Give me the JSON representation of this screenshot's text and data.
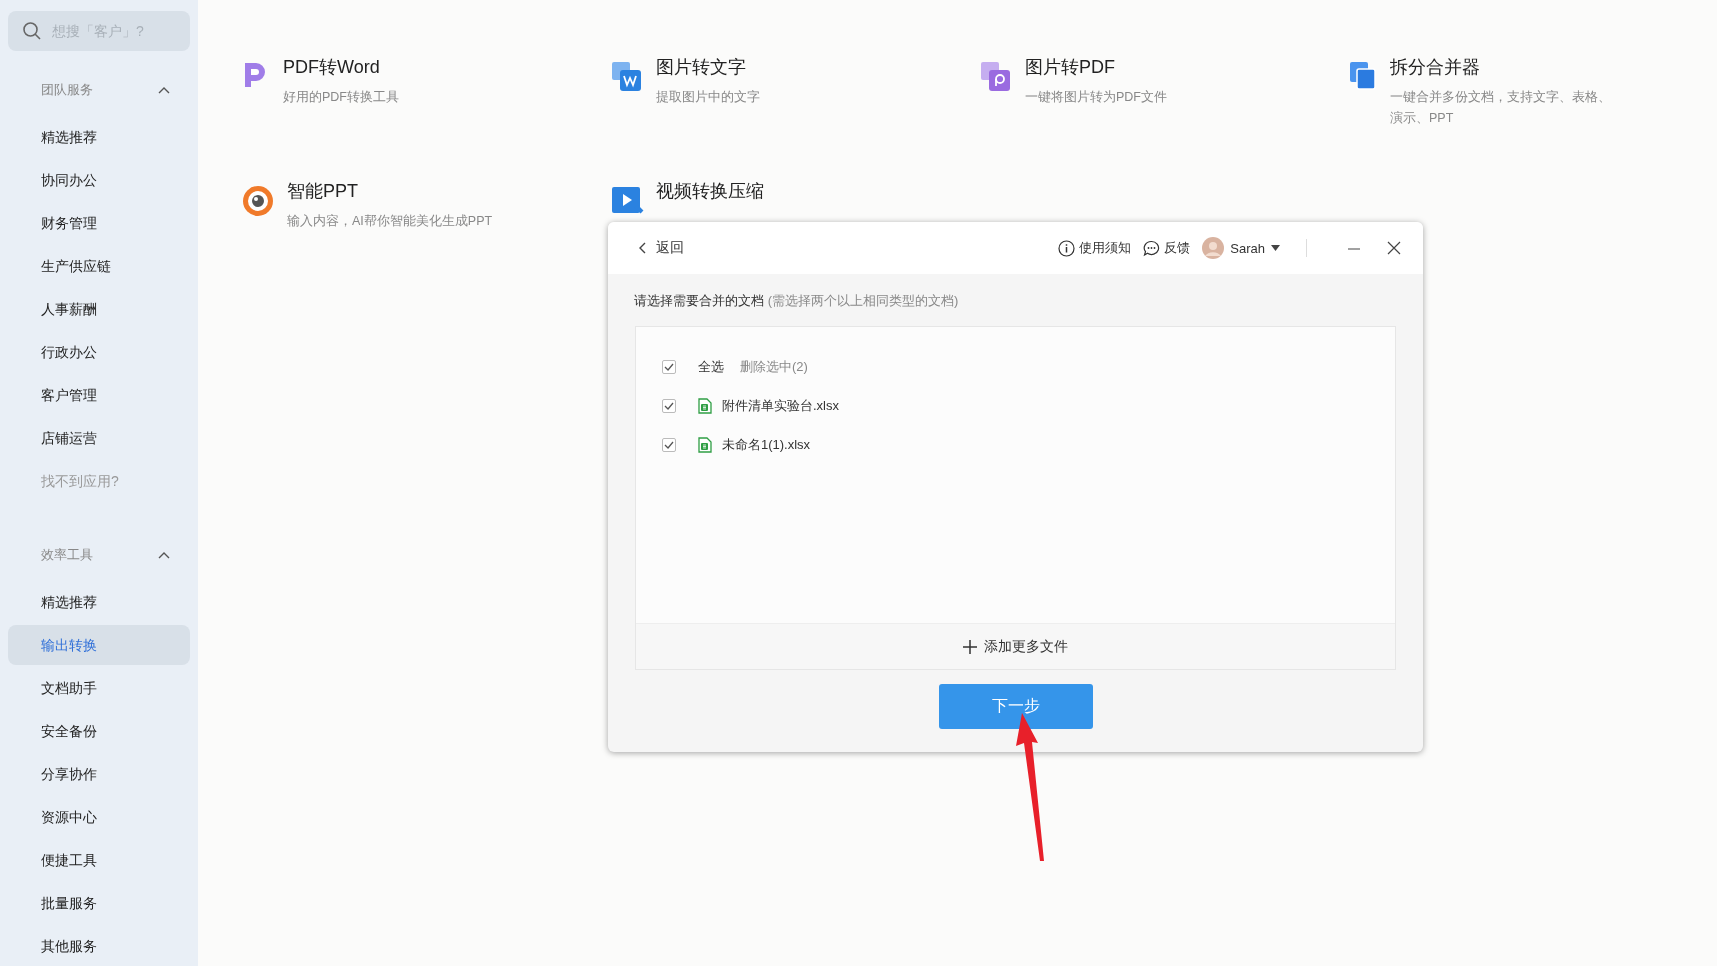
{
  "sidebar": {
    "search": {
      "placeholder": "想搜「客户」?"
    },
    "sections": [
      {
        "title": "团队服务",
        "expanded": true,
        "items": [
          {
            "label": "精选推荐",
            "selected": false,
            "kind": "link"
          },
          {
            "label": "协同办公",
            "selected": false,
            "kind": "link"
          },
          {
            "label": "财务管理",
            "selected": false,
            "kind": "link"
          },
          {
            "label": "生产供应链",
            "selected": false,
            "kind": "link"
          },
          {
            "label": "人事薪酬",
            "selected": false,
            "kind": "link"
          },
          {
            "label": "行政办公",
            "selected": false,
            "kind": "link"
          },
          {
            "label": "客户管理",
            "selected": false,
            "kind": "link"
          },
          {
            "label": "店铺运营",
            "selected": false,
            "kind": "link"
          },
          {
            "label": "找不到应用?",
            "selected": false,
            "kind": "hint"
          }
        ]
      },
      {
        "title": "效率工具",
        "expanded": true,
        "items": [
          {
            "label": "精选推荐",
            "selected": false,
            "kind": "link"
          },
          {
            "label": "输出转换",
            "selected": true,
            "kind": "link"
          },
          {
            "label": "文档助手",
            "selected": false,
            "kind": "link"
          },
          {
            "label": "安全备份",
            "selected": false,
            "kind": "link"
          },
          {
            "label": "分享协作",
            "selected": false,
            "kind": "link"
          },
          {
            "label": "资源中心",
            "selected": false,
            "kind": "link"
          },
          {
            "label": "便捷工具",
            "selected": false,
            "kind": "link"
          },
          {
            "label": "批量服务",
            "selected": false,
            "kind": "link"
          },
          {
            "label": "其他服务",
            "selected": false,
            "kind": "link"
          }
        ]
      }
    ]
  },
  "tools": [
    {
      "name": "PDF转Word",
      "description": "好用的PDF转换工具"
    },
    {
      "name": "图片转文字",
      "description": "提取图片中的文字"
    },
    {
      "name": "图片转PDF",
      "description": "一键将图片转为PDF文件"
    },
    {
      "name": "拆分合并器",
      "description": "一键合并多份文档，支持文字、表格、演示、PPT"
    },
    {
      "name": "智能PPT",
      "description": "输入内容，AI帮你智能美化生成PPT"
    },
    {
      "name": "视频转换压缩"
    }
  ],
  "dialog": {
    "back": "返回",
    "help": "使用须知",
    "feedback": "反馈",
    "user": "Sarah",
    "prompt": "请选择需要合并的文档",
    "hint": "(需选择两个以上相同类型的文档)",
    "select_all": {
      "label": "全选",
      "checked": true
    },
    "delete": "删除选中(2)",
    "files": [
      {
        "name": "附件清单实验台.xlsx",
        "checked": true
      },
      {
        "name": "未命名1(1).xlsx",
        "checked": true
      }
    ],
    "add": "添加更多文件",
    "next": "下一步"
  }
}
